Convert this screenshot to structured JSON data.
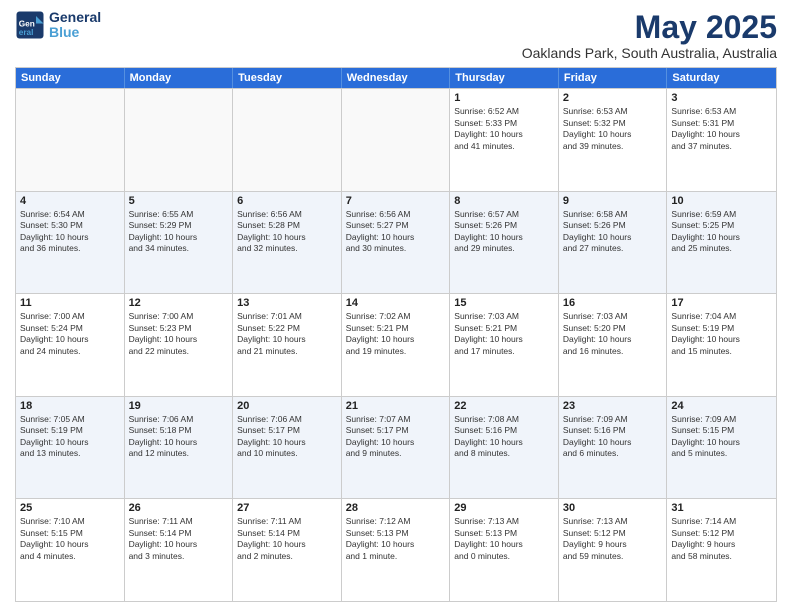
{
  "header": {
    "logo_line1": "General",
    "logo_line2": "Blue",
    "title": "May 2025",
    "subtitle": "Oaklands Park, South Australia, Australia"
  },
  "days": [
    "Sunday",
    "Monday",
    "Tuesday",
    "Wednesday",
    "Thursday",
    "Friday",
    "Saturday"
  ],
  "rows": [
    [
      {
        "day": "",
        "lines": []
      },
      {
        "day": "",
        "lines": []
      },
      {
        "day": "",
        "lines": []
      },
      {
        "day": "",
        "lines": []
      },
      {
        "day": "1",
        "lines": [
          "Sunrise: 6:52 AM",
          "Sunset: 5:33 PM",
          "Daylight: 10 hours",
          "and 41 minutes."
        ]
      },
      {
        "day": "2",
        "lines": [
          "Sunrise: 6:53 AM",
          "Sunset: 5:32 PM",
          "Daylight: 10 hours",
          "and 39 minutes."
        ]
      },
      {
        "day": "3",
        "lines": [
          "Sunrise: 6:53 AM",
          "Sunset: 5:31 PM",
          "Daylight: 10 hours",
          "and 37 minutes."
        ]
      }
    ],
    [
      {
        "day": "4",
        "lines": [
          "Sunrise: 6:54 AM",
          "Sunset: 5:30 PM",
          "Daylight: 10 hours",
          "and 36 minutes."
        ]
      },
      {
        "day": "5",
        "lines": [
          "Sunrise: 6:55 AM",
          "Sunset: 5:29 PM",
          "Daylight: 10 hours",
          "and 34 minutes."
        ]
      },
      {
        "day": "6",
        "lines": [
          "Sunrise: 6:56 AM",
          "Sunset: 5:28 PM",
          "Daylight: 10 hours",
          "and 32 minutes."
        ]
      },
      {
        "day": "7",
        "lines": [
          "Sunrise: 6:56 AM",
          "Sunset: 5:27 PM",
          "Daylight: 10 hours",
          "and 30 minutes."
        ]
      },
      {
        "day": "8",
        "lines": [
          "Sunrise: 6:57 AM",
          "Sunset: 5:26 PM",
          "Daylight: 10 hours",
          "and 29 minutes."
        ]
      },
      {
        "day": "9",
        "lines": [
          "Sunrise: 6:58 AM",
          "Sunset: 5:26 PM",
          "Daylight: 10 hours",
          "and 27 minutes."
        ]
      },
      {
        "day": "10",
        "lines": [
          "Sunrise: 6:59 AM",
          "Sunset: 5:25 PM",
          "Daylight: 10 hours",
          "and 25 minutes."
        ]
      }
    ],
    [
      {
        "day": "11",
        "lines": [
          "Sunrise: 7:00 AM",
          "Sunset: 5:24 PM",
          "Daylight: 10 hours",
          "and 24 minutes."
        ]
      },
      {
        "day": "12",
        "lines": [
          "Sunrise: 7:00 AM",
          "Sunset: 5:23 PM",
          "Daylight: 10 hours",
          "and 22 minutes."
        ]
      },
      {
        "day": "13",
        "lines": [
          "Sunrise: 7:01 AM",
          "Sunset: 5:22 PM",
          "Daylight: 10 hours",
          "and 21 minutes."
        ]
      },
      {
        "day": "14",
        "lines": [
          "Sunrise: 7:02 AM",
          "Sunset: 5:21 PM",
          "Daylight: 10 hours",
          "and 19 minutes."
        ]
      },
      {
        "day": "15",
        "lines": [
          "Sunrise: 7:03 AM",
          "Sunset: 5:21 PM",
          "Daylight: 10 hours",
          "and 17 minutes."
        ]
      },
      {
        "day": "16",
        "lines": [
          "Sunrise: 7:03 AM",
          "Sunset: 5:20 PM",
          "Daylight: 10 hours",
          "and 16 minutes."
        ]
      },
      {
        "day": "17",
        "lines": [
          "Sunrise: 7:04 AM",
          "Sunset: 5:19 PM",
          "Daylight: 10 hours",
          "and 15 minutes."
        ]
      }
    ],
    [
      {
        "day": "18",
        "lines": [
          "Sunrise: 7:05 AM",
          "Sunset: 5:19 PM",
          "Daylight: 10 hours",
          "and 13 minutes."
        ]
      },
      {
        "day": "19",
        "lines": [
          "Sunrise: 7:06 AM",
          "Sunset: 5:18 PM",
          "Daylight: 10 hours",
          "and 12 minutes."
        ]
      },
      {
        "day": "20",
        "lines": [
          "Sunrise: 7:06 AM",
          "Sunset: 5:17 PM",
          "Daylight: 10 hours",
          "and 10 minutes."
        ]
      },
      {
        "day": "21",
        "lines": [
          "Sunrise: 7:07 AM",
          "Sunset: 5:17 PM",
          "Daylight: 10 hours",
          "and 9 minutes."
        ]
      },
      {
        "day": "22",
        "lines": [
          "Sunrise: 7:08 AM",
          "Sunset: 5:16 PM",
          "Daylight: 10 hours",
          "and 8 minutes."
        ]
      },
      {
        "day": "23",
        "lines": [
          "Sunrise: 7:09 AM",
          "Sunset: 5:16 PM",
          "Daylight: 10 hours",
          "and 6 minutes."
        ]
      },
      {
        "day": "24",
        "lines": [
          "Sunrise: 7:09 AM",
          "Sunset: 5:15 PM",
          "Daylight: 10 hours",
          "and 5 minutes."
        ]
      }
    ],
    [
      {
        "day": "25",
        "lines": [
          "Sunrise: 7:10 AM",
          "Sunset: 5:15 PM",
          "Daylight: 10 hours",
          "and 4 minutes."
        ]
      },
      {
        "day": "26",
        "lines": [
          "Sunrise: 7:11 AM",
          "Sunset: 5:14 PM",
          "Daylight: 10 hours",
          "and 3 minutes."
        ]
      },
      {
        "day": "27",
        "lines": [
          "Sunrise: 7:11 AM",
          "Sunset: 5:14 PM",
          "Daylight: 10 hours",
          "and 2 minutes."
        ]
      },
      {
        "day": "28",
        "lines": [
          "Sunrise: 7:12 AM",
          "Sunset: 5:13 PM",
          "Daylight: 10 hours",
          "and 1 minute."
        ]
      },
      {
        "day": "29",
        "lines": [
          "Sunrise: 7:13 AM",
          "Sunset: 5:13 PM",
          "Daylight: 10 hours",
          "and 0 minutes."
        ]
      },
      {
        "day": "30",
        "lines": [
          "Sunrise: 7:13 AM",
          "Sunset: 5:12 PM",
          "Daylight: 9 hours",
          "and 59 minutes."
        ]
      },
      {
        "day": "31",
        "lines": [
          "Sunrise: 7:14 AM",
          "Sunset: 5:12 PM",
          "Daylight: 9 hours",
          "and 58 minutes."
        ]
      }
    ]
  ]
}
